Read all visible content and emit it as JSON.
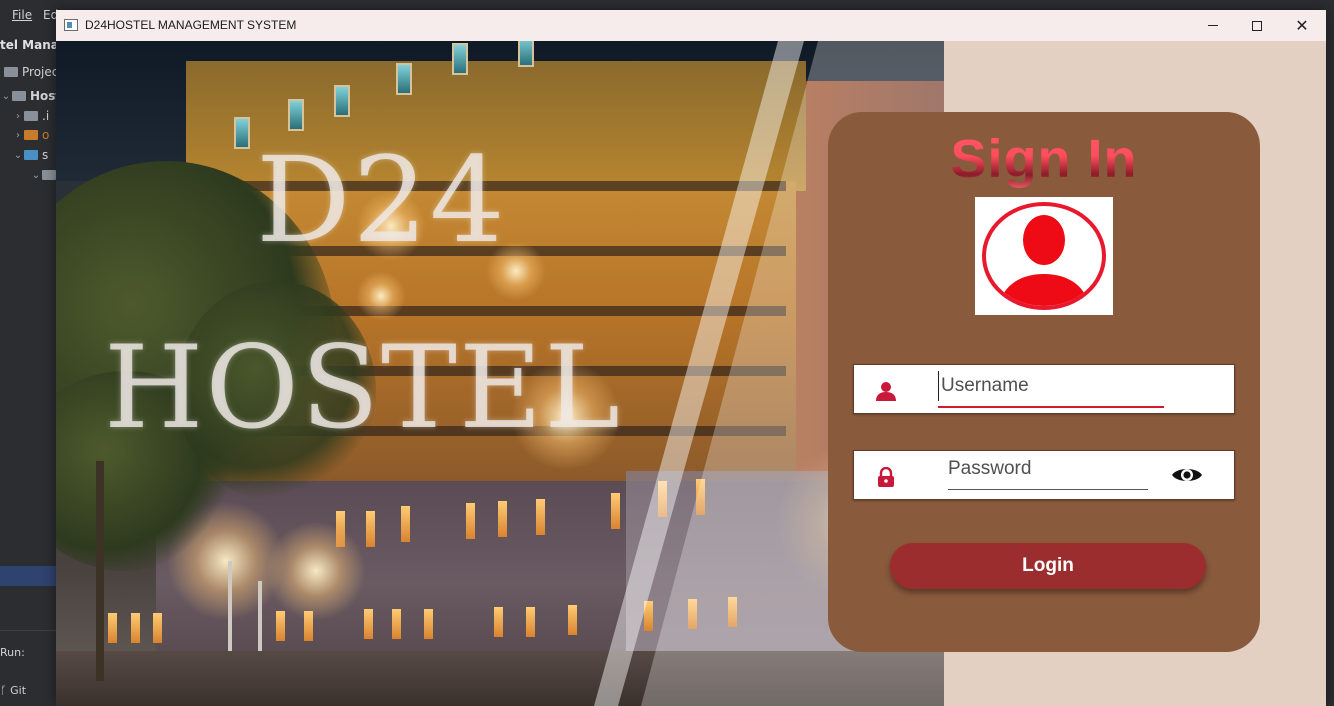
{
  "ide": {
    "menu": [
      "File",
      "Ed"
    ],
    "project_title": "tel Manag",
    "tree": [
      "Projec",
      "Host",
      ".i",
      "o",
      "s",
      ""
    ],
    "run_label": "Run:",
    "git_label": "Git"
  },
  "window": {
    "title": "D24HOSTEL MANAGEMENT SYSTEM",
    "minimize_icon": "minimize-icon",
    "maximize_icon": "maximize-icon",
    "close_icon": "close-icon",
    "close_glyph": "✕"
  },
  "hero": {
    "line1": "D24",
    "line2": "HOSTEL"
  },
  "login": {
    "heading": "Sign In",
    "avatar_icon": "user-avatar-icon",
    "username": {
      "placeholder": "Username",
      "value": "",
      "icon": "user-icon"
    },
    "password": {
      "placeholder": "Password",
      "value": "",
      "icon": "lock-icon",
      "toggle_icon": "eye-icon"
    },
    "button_label": "Login"
  },
  "colors": {
    "card": "#8a5a3c",
    "button": "#9c2d2e",
    "accent_red": "#e8192c",
    "window_bg": "#e3d0c3"
  }
}
